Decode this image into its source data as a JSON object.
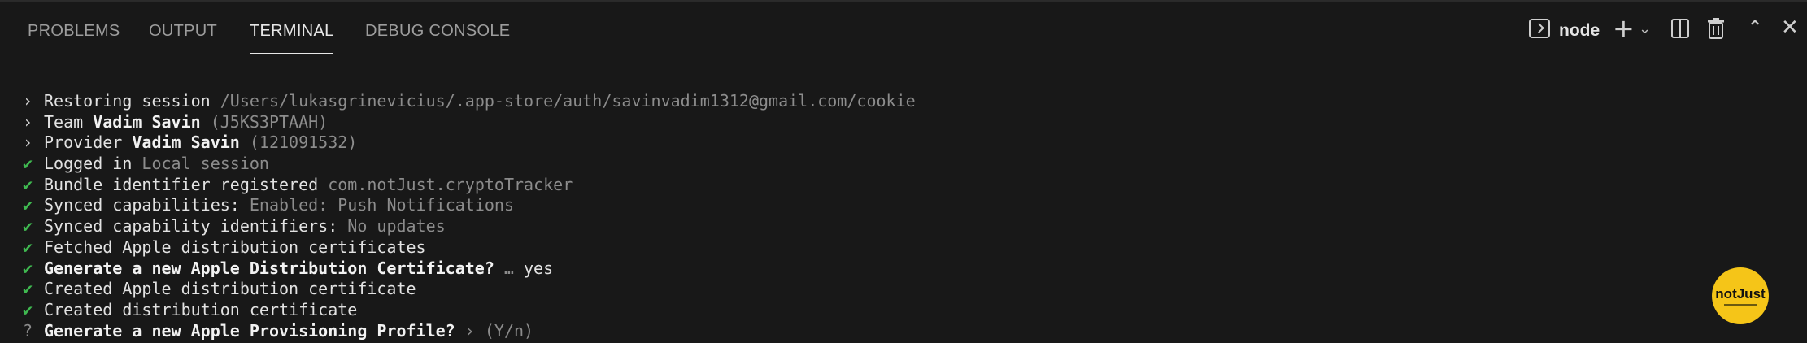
{
  "tabs": [
    {
      "label": "PROBLEMS",
      "active": false
    },
    {
      "label": "OUTPUT",
      "active": false
    },
    {
      "label": "TERMINAL",
      "active": true
    },
    {
      "label": "DEBUG CONSOLE",
      "active": false
    }
  ],
  "toolbar": {
    "terminal_name": "node",
    "icons": [
      "terminal-icon",
      "plus-icon",
      "chevron-down-icon",
      "split-icon",
      "trash-icon",
      "chevron-up-icon",
      "close-icon"
    ]
  },
  "terminal": {
    "lines": [
      {
        "mark": "›",
        "kind": "arrow",
        "parts": [
          {
            "t": "Restoring session ",
            "s": "n"
          },
          {
            "t": "/Users/lukasgrinevicius/.app-store/auth/savinvadim1312@gmail.com/cookie",
            "s": "dim"
          }
        ]
      },
      {
        "mark": "›",
        "kind": "arrow",
        "parts": [
          {
            "t": "Team ",
            "s": "n"
          },
          {
            "t": "Vadim Savin",
            "s": "b"
          },
          {
            "t": " (J5KS3PTAAH)",
            "s": "dim"
          }
        ]
      },
      {
        "mark": "›",
        "kind": "arrow",
        "parts": [
          {
            "t": "Provider ",
            "s": "n"
          },
          {
            "t": "Vadim Savin",
            "s": "b"
          },
          {
            "t": " (121091532)",
            "s": "dim"
          }
        ]
      },
      {
        "mark": "✔",
        "kind": "check",
        "parts": [
          {
            "t": "Logged in ",
            "s": "n"
          },
          {
            "t": "Local session",
            "s": "dim"
          }
        ]
      },
      {
        "mark": "✔",
        "kind": "check",
        "parts": [
          {
            "t": "Bundle identifier registered ",
            "s": "n"
          },
          {
            "t": "com.notJust.cryptoTracker",
            "s": "dim"
          }
        ]
      },
      {
        "mark": "✔",
        "kind": "check",
        "parts": [
          {
            "t": "Synced capabilities: ",
            "s": "n"
          },
          {
            "t": "Enabled: Push Notifications",
            "s": "dim"
          }
        ]
      },
      {
        "mark": "✔",
        "kind": "check",
        "parts": [
          {
            "t": "Synced capability identifiers: ",
            "s": "n"
          },
          {
            "t": "No updates",
            "s": "dim"
          }
        ]
      },
      {
        "mark": "✔",
        "kind": "check",
        "parts": [
          {
            "t": "Fetched Apple distribution certificates",
            "s": "n"
          }
        ]
      },
      {
        "mark": "✔",
        "kind": "check",
        "parts": [
          {
            "t": "Generate a new Apple Distribution Certificate?",
            "s": "b"
          },
          {
            "t": " … ",
            "s": "dim"
          },
          {
            "t": "yes",
            "s": "n"
          }
        ]
      },
      {
        "mark": "✔",
        "kind": "check",
        "parts": [
          {
            "t": "Created Apple distribution certificate",
            "s": "n"
          }
        ]
      },
      {
        "mark": "✔",
        "kind": "check",
        "parts": [
          {
            "t": "Created distribution certificate",
            "s": "n"
          }
        ]
      },
      {
        "mark": "?",
        "kind": "q",
        "parts": [
          {
            "t": "Generate a new Apple Provisioning Profile?",
            "s": "b"
          },
          {
            "t": " › (Y/n)",
            "s": "dim"
          }
        ]
      }
    ]
  },
  "logo": {
    "text": "notJust"
  },
  "colors": {
    "background": "#181818",
    "success": "#3fb950",
    "dim": "#8c8c8c",
    "logo": "#f5c518"
  }
}
